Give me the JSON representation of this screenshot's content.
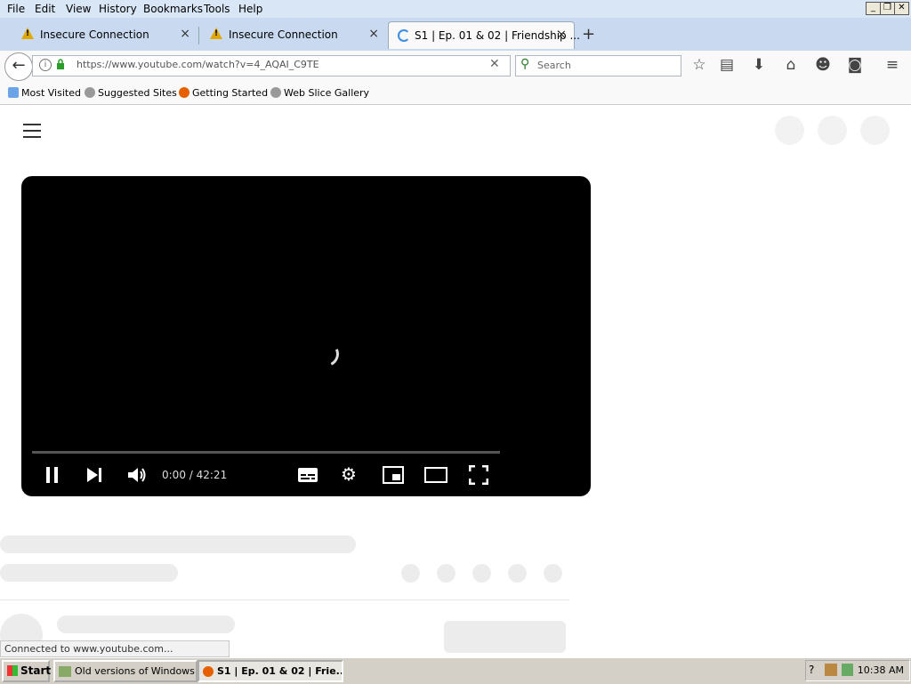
{
  "menubar": {
    "items": [
      "File",
      "Edit",
      "View",
      "History",
      "Bookmarks",
      "Tools",
      "Help"
    ]
  },
  "tabs": [
    {
      "label": "Insecure Connection",
      "icon": "warning-icon"
    },
    {
      "label": "Insecure Connection",
      "icon": "warning-icon"
    },
    {
      "label": "S1 | Ep. 01 & 02 | Friendship ...",
      "icon": "loading-spinner-icon",
      "active": true
    }
  ],
  "navbar": {
    "url": "https://www.youtube.com/watch?v=4_AQAI_C9TE",
    "search_placeholder": "Search",
    "toolbar_icons": [
      "star-icon",
      "reading-list-icon",
      "download-icon",
      "home-icon",
      "chat-icon",
      "pocket-icon",
      "menu-icon"
    ]
  },
  "bookmarks": [
    "Most Visited",
    "Suggested Sites",
    "Getting Started",
    "Web Slice Gallery"
  ],
  "player": {
    "time": "0:00 / 42:21"
  },
  "status": {
    "text": "Connected to www.youtube.com..."
  },
  "taskbar": {
    "start": "Start",
    "items": [
      {
        "label": "Old versions of Windows...",
        "active": false
      },
      {
        "label": "S1 | Ep. 01 & 02 | Frie...",
        "active": true
      }
    ],
    "clock": "10:38 AM"
  }
}
